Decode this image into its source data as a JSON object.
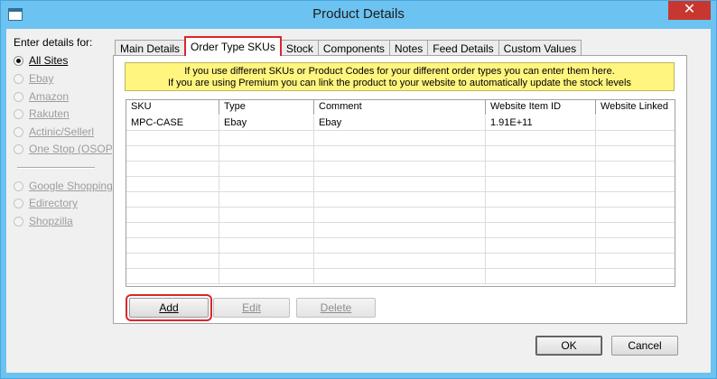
{
  "window": {
    "title": "Product Details",
    "close_symbol": "✕"
  },
  "sites": {
    "label": "Enter details for:",
    "options": [
      {
        "label": "All Sites",
        "checked": true,
        "enabled": true
      },
      {
        "label": "Ebay",
        "checked": false,
        "enabled": false
      },
      {
        "label": "Amazon",
        "checked": false,
        "enabled": false
      },
      {
        "label": "Rakuten",
        "checked": false,
        "enabled": false
      },
      {
        "label": "Actinic/Sellerl",
        "checked": false,
        "enabled": false
      },
      {
        "label": "One Stop (OSOP)",
        "checked": false,
        "enabled": false
      }
    ],
    "options2": [
      {
        "label": "Google Shopping",
        "checked": false,
        "enabled": false
      },
      {
        "label": "Edirectory",
        "checked": false,
        "enabled": false
      },
      {
        "label": "Shopzilla",
        "checked": false,
        "enabled": false
      }
    ]
  },
  "tabs": [
    {
      "label": "Main Details"
    },
    {
      "label": "Order Type SKUs"
    },
    {
      "label": "Stock"
    },
    {
      "label": "Components"
    },
    {
      "label": "Notes"
    },
    {
      "label": "Feed Details"
    },
    {
      "label": "Custom Values"
    }
  ],
  "info": {
    "line1": "If you use different SKUs or Product Codes for your different order types you can enter them here.",
    "line2": "If you are using Premium you can link the product to your website to automatically update the stock levels"
  },
  "grid": {
    "columns": [
      "SKU",
      "Type",
      "Comment",
      "Website Item ID",
      "Website Linked"
    ],
    "rows": [
      [
        "MPC-CASE",
        "Ebay",
        "Ebay",
        "1.91E+11",
        ""
      ]
    ]
  },
  "buttons": {
    "add": "Add",
    "edit": "Edit",
    "delete": "Delete",
    "ok": "OK",
    "cancel": "Cancel"
  }
}
